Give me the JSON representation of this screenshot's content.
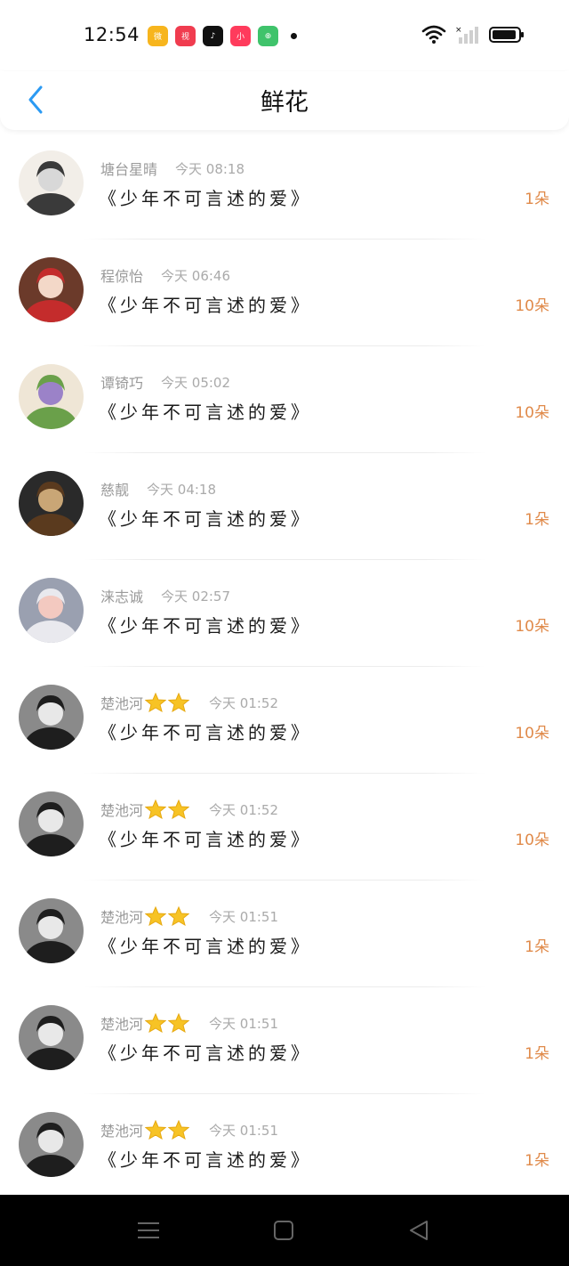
{
  "status_bar": {
    "time": "12:54",
    "apps": [
      {
        "icon": "weibo-app-icon",
        "glyph": "微"
      },
      {
        "icon": "video-app-icon",
        "glyph": "视"
      },
      {
        "icon": "tiktok-app-icon",
        "glyph": "♪"
      },
      {
        "icon": "xiaohongshu-app-icon",
        "glyph": "小"
      },
      {
        "icon": "store-app-icon",
        "glyph": "⊕"
      }
    ]
  },
  "header": {
    "title": "鲜花",
    "back_icon": "chevron-left-icon"
  },
  "accent_color": "#e08a4a",
  "list": [
    {
      "name": "塘台星晴",
      "stars": 0,
      "time": "今天 08:18",
      "book": "《少年不可言述的爱》",
      "count": "1朵",
      "avatar_palette": [
        "#3a3a3a",
        "#d8d8d8",
        "#f2eee8"
      ]
    },
    {
      "name": "程倞怡",
      "stars": 0,
      "time": "今天 06:46",
      "book": "《少年不可言述的爱》",
      "count": "10朵",
      "avatar_palette": [
        "#c42c2c",
        "#f3d8c8",
        "#6b3a2a"
      ]
    },
    {
      "name": "谭锜巧",
      "stars": 0,
      "time": "今天 05:02",
      "book": "《少年不可言述的爱》",
      "count": "10朵",
      "avatar_palette": [
        "#6aa04a",
        "#9b82c8",
        "#efe6d6"
      ]
    },
    {
      "name": "慈靓",
      "stars": 0,
      "time": "今天 04:18",
      "book": "《少年不可言述的爱》",
      "count": "1朵",
      "avatar_palette": [
        "#5a3a1e",
        "#c9a676",
        "#2a2a2a"
      ]
    },
    {
      "name": "涞志诚",
      "stars": 0,
      "time": "今天 02:57",
      "book": "《少年不可言述的爱》",
      "count": "10朵",
      "avatar_palette": [
        "#e9e9ee",
        "#f3c9c0",
        "#9aa0b0"
      ]
    },
    {
      "name": "楚池河",
      "stars": 2,
      "time": "今天 01:52",
      "book": "《少年不可言述的爱》",
      "count": "10朵",
      "avatar_palette": [
        "#1e1e1e",
        "#e8e8e8",
        "#8a8a8a"
      ]
    },
    {
      "name": "楚池河",
      "stars": 2,
      "time": "今天 01:52",
      "book": "《少年不可言述的爱》",
      "count": "10朵",
      "avatar_palette": [
        "#1e1e1e",
        "#e8e8e8",
        "#8a8a8a"
      ]
    },
    {
      "name": "楚池河",
      "stars": 2,
      "time": "今天 01:51",
      "book": "《少年不可言述的爱》",
      "count": "1朵",
      "avatar_palette": [
        "#1e1e1e",
        "#e8e8e8",
        "#8a8a8a"
      ]
    },
    {
      "name": "楚池河",
      "stars": 2,
      "time": "今天 01:51",
      "book": "《少年不可言述的爱》",
      "count": "1朵",
      "avatar_palette": [
        "#1e1e1e",
        "#e8e8e8",
        "#8a8a8a"
      ]
    },
    {
      "name": "楚池河",
      "stars": 2,
      "time": "今天 01:51",
      "book": "《少年不可言述的爱》",
      "count": "1朵",
      "avatar_palette": [
        "#1e1e1e",
        "#e8e8e8",
        "#8a8a8a"
      ]
    }
  ],
  "nav_bar": {
    "menu_icon": "menu-icon",
    "home_icon": "home-square-icon",
    "back_icon": "back-triangle-icon"
  }
}
